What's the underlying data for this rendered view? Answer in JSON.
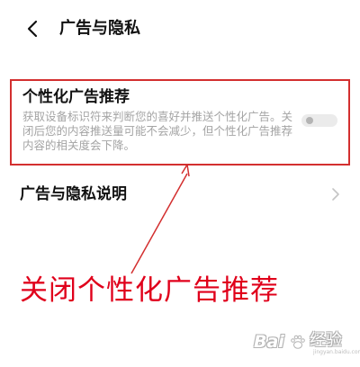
{
  "header": {
    "back_icon": "chevron-left-icon",
    "title": "广告与隐私"
  },
  "personalized_ads": {
    "title": "个性化广告推荐",
    "description": "获取设备标识符来判断您的喜好并推送个性化广告。关闭后您的内容推送量可能不会减少，但个性化广告推荐内容的相关度会下降。",
    "toggle_on": false,
    "highlight_color": "#d32f2f"
  },
  "menu": {
    "items": [
      {
        "label": "广告与隐私说明",
        "icon": "chevron-right-icon"
      }
    ]
  },
  "annotation": {
    "text": "关闭个性化广告推荐",
    "color": "#e0001b"
  },
  "watermark": {
    "brand": "Bai",
    "icon": "baidu-paw-icon",
    "text": "经验",
    "sub": "jingyan.baidu.com"
  }
}
